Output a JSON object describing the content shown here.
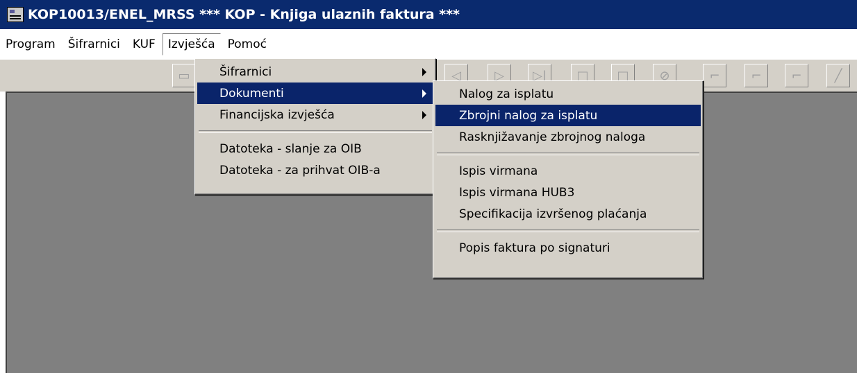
{
  "window": {
    "title": "KOP10013/ENEL_MRSS *** KOP - Knjiga ulaznih faktura ***"
  },
  "menubar": {
    "items": [
      {
        "label": "Program"
      },
      {
        "label": "Šifrarnici"
      },
      {
        "label": "KUF"
      },
      {
        "label": "Izvješća"
      },
      {
        "label": "Pomoć"
      }
    ]
  },
  "izvjesca_menu": {
    "items": [
      {
        "label": "Šifrarnici"
      },
      {
        "label": "Dokumenti"
      },
      {
        "label": "Financijska izvješća"
      },
      {
        "label": "Datoteka - slanje za OIB"
      },
      {
        "label": "Datoteka - za prihvat OIB-a"
      }
    ]
  },
  "dokumenti_submenu": {
    "items": [
      {
        "label": "Nalog za isplatu"
      },
      {
        "label": "Zbrojni nalog za isplatu"
      },
      {
        "label": "Rasknjižavanje zbrojnog naloga"
      },
      {
        "label": "Ispis virmana"
      },
      {
        "label": "Ispis virmana HUB3"
      },
      {
        "label": "Specifikacija izvršenog plaćanja"
      },
      {
        "label": "Popis faktura po signaturi"
      }
    ]
  },
  "icons": [
    "app-icon",
    "first-record-icon",
    "previous-icon",
    "next-icon",
    "last-record-icon",
    "new-record-icon",
    "edit-record-icon",
    "delete-record-icon",
    "save-icon",
    "undo-icon",
    "refresh-icon",
    "clear-icon"
  ],
  "colors": {
    "titlebar": "#0a2a6e",
    "selection": "#0a246a",
    "workarea": "#808080",
    "menu_bg": "#d4d0c8"
  }
}
